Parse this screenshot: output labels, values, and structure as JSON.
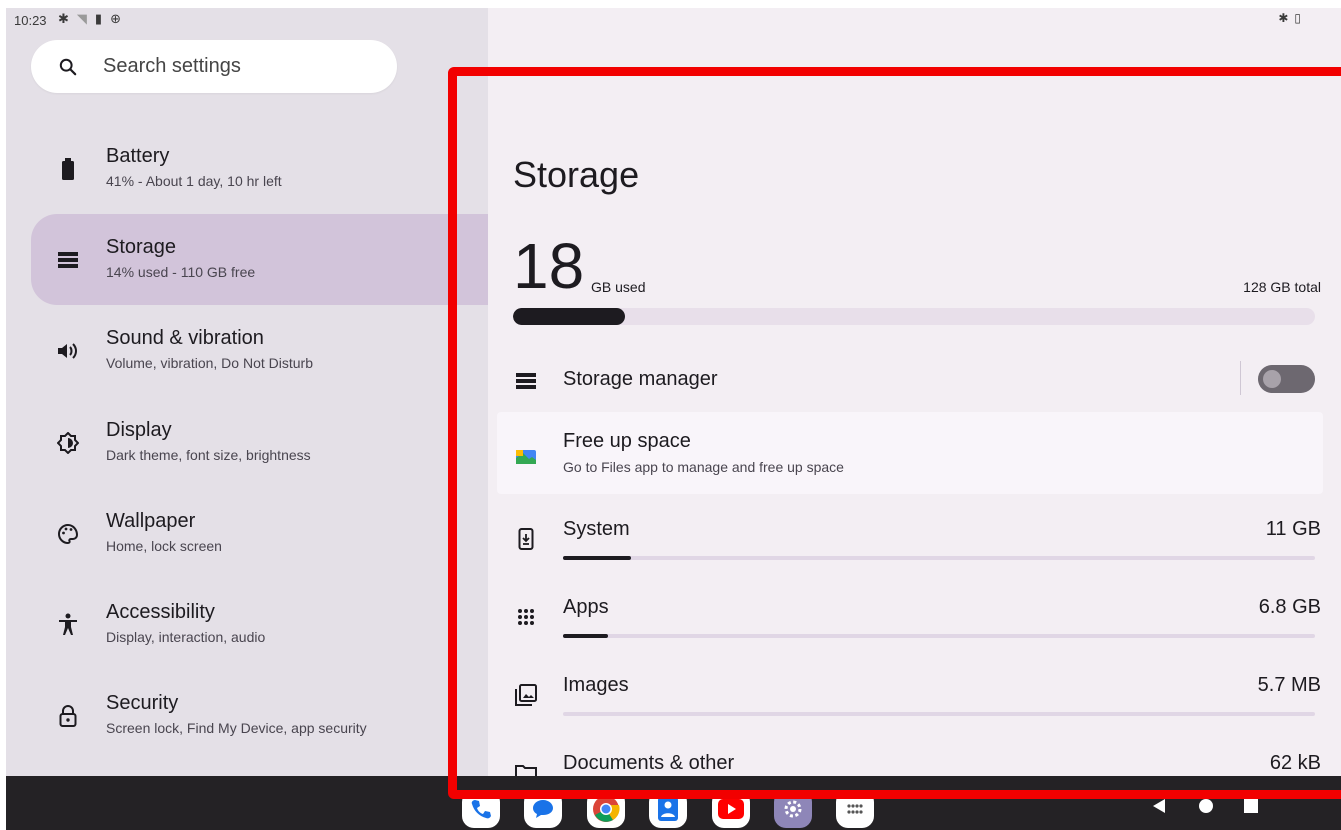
{
  "status_bar": {
    "time": "10:23",
    "left_icons": [
      "gear-icon",
      "wifi-icon",
      "sim-icon",
      "vpn-icon"
    ],
    "right_icons": [
      "bluetooth-icon",
      "battery-icon"
    ]
  },
  "search": {
    "placeholder": "Search settings"
  },
  "sidebar": {
    "items": [
      {
        "icon": "battery-icon",
        "title": "Battery",
        "subtitle": "41% - About 1 day, 10 hr left",
        "selected": false
      },
      {
        "icon": "storage-icon",
        "title": "Storage",
        "subtitle": "14% used - 110 GB free",
        "selected": true
      },
      {
        "icon": "volume-icon",
        "title": "Sound & vibration",
        "subtitle": "Volume, vibration, Do Not Disturb",
        "selected": false
      },
      {
        "icon": "display-icon",
        "title": "Display",
        "subtitle": "Dark theme, font size, brightness",
        "selected": false
      },
      {
        "icon": "palette-icon",
        "title": "Wallpaper",
        "subtitle": "Home, lock screen",
        "selected": false
      },
      {
        "icon": "accessibility-icon",
        "title": "Accessibility",
        "subtitle": "Display, interaction, audio",
        "selected": false
      },
      {
        "icon": "lock-icon",
        "title": "Security",
        "subtitle": "Screen lock, Find My Device, app security",
        "selected": false
      }
    ]
  },
  "storage": {
    "title": "Storage",
    "used_value": "18",
    "used_unit": "GB used",
    "total": "128 GB total",
    "used_fraction": 0.14,
    "manager": {
      "label": "Storage manager",
      "enabled": false
    },
    "free_up": {
      "title": "Free up space",
      "subtitle": "Go to Files app to manage and free up space"
    },
    "categories": [
      {
        "icon": "system-icon",
        "label": "System",
        "value": "11 GB",
        "fraction": 0.09
      },
      {
        "icon": "apps-grid-icon",
        "label": "Apps",
        "value": "6.8 GB",
        "fraction": 0.06
      },
      {
        "icon": "images-icon",
        "label": "Images",
        "value": "5.7 MB",
        "fraction": 0.0
      },
      {
        "icon": "folder-icon",
        "label": "Documents & other",
        "value": "62 kB",
        "fraction": 0.0
      }
    ]
  },
  "taskbar": {
    "apps": [
      "phone-app-icon",
      "messages-app-icon",
      "chrome-app-icon",
      "contacts-app-icon",
      "youtube-app-icon",
      "settings-app-icon",
      "app-drawer-icon"
    ],
    "nav": [
      "back-button",
      "home-button",
      "recents-button"
    ]
  },
  "colors": {
    "highlight_border": "#f20000",
    "selected_item_bg": "#d2c4da",
    "taskbar_bg": "#242225"
  }
}
